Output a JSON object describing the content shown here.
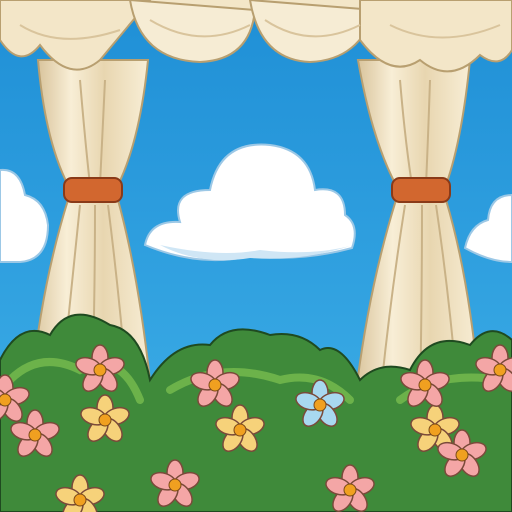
{
  "scene": {
    "colors": {
      "sky_top": "#1f8fd6",
      "sky_bottom": "#3fb0e8",
      "cloud": "#ffffff",
      "cloud_shadow": "#cfe6f5",
      "curtain": "#f3e6c8",
      "curtain_shadow": "#d9c49c",
      "tieback": "#d2672f",
      "bush": "#3f8a3a",
      "bush_light": "#6cb24a",
      "flower_pink": "#f4a6a6",
      "flower_yellow": "#f6d27a",
      "flower_blue": "#a8d8f0",
      "flower_center": "#f0a020"
    },
    "flowers": [
      {
        "color": "pink"
      },
      {
        "color": "yellow"
      },
      {
        "color": "pink"
      },
      {
        "color": "pink"
      },
      {
        "color": "pink"
      },
      {
        "color": "yellow"
      },
      {
        "color": "blue"
      },
      {
        "color": "pink"
      },
      {
        "color": "yellow"
      },
      {
        "color": "pink"
      },
      {
        "color": "yellow"
      },
      {
        "color": "pink"
      },
      {
        "color": "pink"
      },
      {
        "color": "pink"
      }
    ]
  }
}
